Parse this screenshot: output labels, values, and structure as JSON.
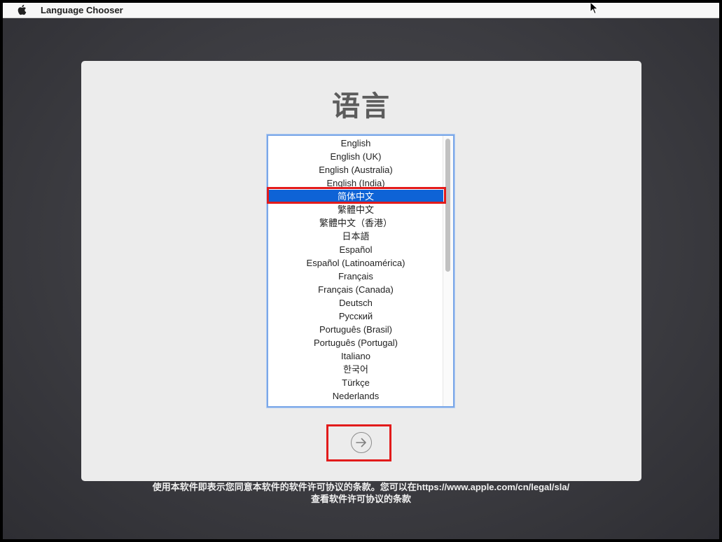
{
  "menubar": {
    "title": "Language Chooser"
  },
  "panel": {
    "title": "语言"
  },
  "languages": [
    "English",
    "English (UK)",
    "English (Australia)",
    "English (India)",
    "简体中文",
    "繁體中文",
    "繁體中文（香港）",
    "日本語",
    "Español",
    "Español (Latinoamérica)",
    "Français",
    "Français (Canada)",
    "Deutsch",
    "Русский",
    "Português (Brasil)",
    "Português (Portugal)",
    "Italiano",
    "한국어",
    "Türkçe",
    "Nederlands"
  ],
  "selected_language": "简体中文",
  "footer": {
    "line1_prefix": "使用本软件即表示您同意本软件的软件许可协议的条款。您可以在",
    "line1_link": "https://www.apple.com/cn/legal/sla/",
    "line2": "查看软件许可协议的条款"
  },
  "icons": {
    "apple": "apple-icon",
    "next": "arrow-right-circle-icon",
    "cursor": "mouse-cursor-icon"
  },
  "colors": {
    "selection": "#0e63d6",
    "annotation": "#e21b1b",
    "list_border": "#7aa7e8"
  }
}
